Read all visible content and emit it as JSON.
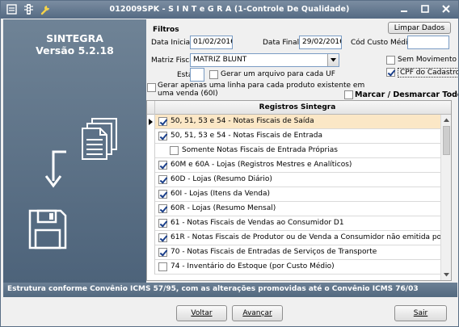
{
  "window": {
    "title": "012009SPK - S I N T e G R A (1-Controle De Qualidade)"
  },
  "left_panel": {
    "app_name": "SINTEGRA",
    "version": "Versão 5.2.18"
  },
  "filters": {
    "section_title": "Filtros",
    "clear_button": "Limpar Dados",
    "data_inicial_label": "Data Inicial:",
    "data_inicial_value": "01/02/2016",
    "data_final_label": "Data Final:",
    "data_final_value": "29/02/2016",
    "cod_custo_label": "Cód Custo Médio:",
    "cod_custo_value": "",
    "matriz_label": "Matriz Fiscal:",
    "matriz_value": "MATRIZ BLUNT",
    "sem_movimento_label": "Sem Movimento",
    "sem_movimento_checked": false,
    "estado_label": "Estado:",
    "estado_value": "",
    "gerar_arquivo_label": "Gerar um arquivo para cada UF",
    "gerar_arquivo_checked": false,
    "cpf_cadastro_label": "CPF do Cadastro",
    "cpf_cadastro_checked": true,
    "gerar_linha_label_1": "Gerar apenas uma linha para cada produto existente em",
    "gerar_linha_label_2": "uma venda (60I)",
    "gerar_linha_checked": false,
    "marcar_todos_label": "Marcar / Desmarcar Todos",
    "marcar_todos_checked": false
  },
  "registros": {
    "header": "Registros Sintegra",
    "rows": [
      {
        "label": "50, 51, 53 e 54 - Notas Fiscais de Saída",
        "checked": true,
        "indent": 0,
        "selected": true
      },
      {
        "label": "50, 51, 53 e 54 - Notas Fiscais de Entrada",
        "checked": true,
        "indent": 0,
        "selected": false
      },
      {
        "label": "Somente Notas Fiscais de Entrada Próprias",
        "checked": false,
        "indent": 1,
        "selected": false
      },
      {
        "label": "60M e 60A - Lojas (Registros Mestres e Analíticos)",
        "checked": true,
        "indent": 0,
        "selected": false
      },
      {
        "label": "60D - Lojas (Resumo Diário)",
        "checked": true,
        "indent": 0,
        "selected": false
      },
      {
        "label": "60I - Lojas (Itens da Venda)",
        "checked": true,
        "indent": 0,
        "selected": false
      },
      {
        "label": "60R - Lojas (Resumo Mensal)",
        "checked": true,
        "indent": 0,
        "selected": false
      },
      {
        "label": "61 - Notas Fiscais de Vendas ao Consumidor D1",
        "checked": true,
        "indent": 0,
        "selected": false
      },
      {
        "label": "61R - Notas Fiscais de Produtor ou de Venda a Consumidor não emitida por ECF",
        "checked": true,
        "indent": 0,
        "selected": false
      },
      {
        "label": "70 - Notas Fiscais de Entradas de Serviços de Transporte",
        "checked": true,
        "indent": 0,
        "selected": false
      },
      {
        "label": "74 - Inventário do Estoque (por Custo Médio)",
        "checked": false,
        "indent": 0,
        "selected": false
      }
    ]
  },
  "status_text": "Estrutura conforme Convênio ICMS 57/95, com as alterações promovidas até o Convênio ICMS 76/03",
  "buttons": {
    "voltar": "Voltar",
    "avancar": "Avançar",
    "sair": "Sair"
  },
  "colors": {
    "titlebar": "#5f7590",
    "left_panel": "#5c7187",
    "selected_row": "#fbe7c6",
    "field_border": "#7a9cc4"
  }
}
